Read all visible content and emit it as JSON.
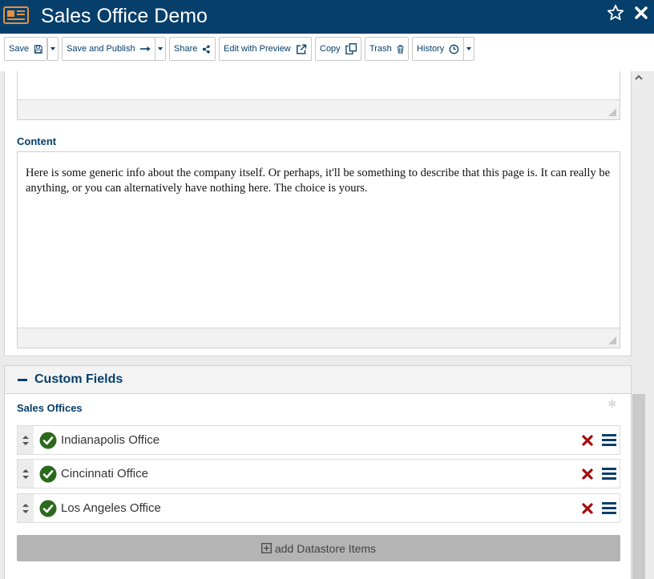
{
  "header": {
    "title": "Sales Office Demo",
    "icons": {
      "doc": "newspaper-icon",
      "favorite": "star-icon",
      "close": "close-icon"
    }
  },
  "toolbar": {
    "save": "Save",
    "save_and_publish": "Save and Publish",
    "share": "Share",
    "edit_with_preview": "Edit with Preview",
    "copy": "Copy",
    "trash": "Trash",
    "history": "History"
  },
  "content": {
    "label": "Content",
    "body": "Here is some generic info about the company itself. Or perhaps, it'll be something to describe that this page is. It can really be anything, or you can alternatively have nothing here. The choice is yours."
  },
  "custom_fields": {
    "title": "Custom Fields",
    "field_label": "Sales Offices",
    "items": [
      {
        "name": "Indianapolis Office"
      },
      {
        "name": "Cincinnati Office"
      },
      {
        "name": "Los Angeles Office"
      }
    ],
    "add_button": "add Datastore Items"
  },
  "colors": {
    "brand": "#063f6b",
    "check": "#2b6a1d",
    "remove": "#a40e0e",
    "add_button_bg": "#b4b4b4"
  }
}
